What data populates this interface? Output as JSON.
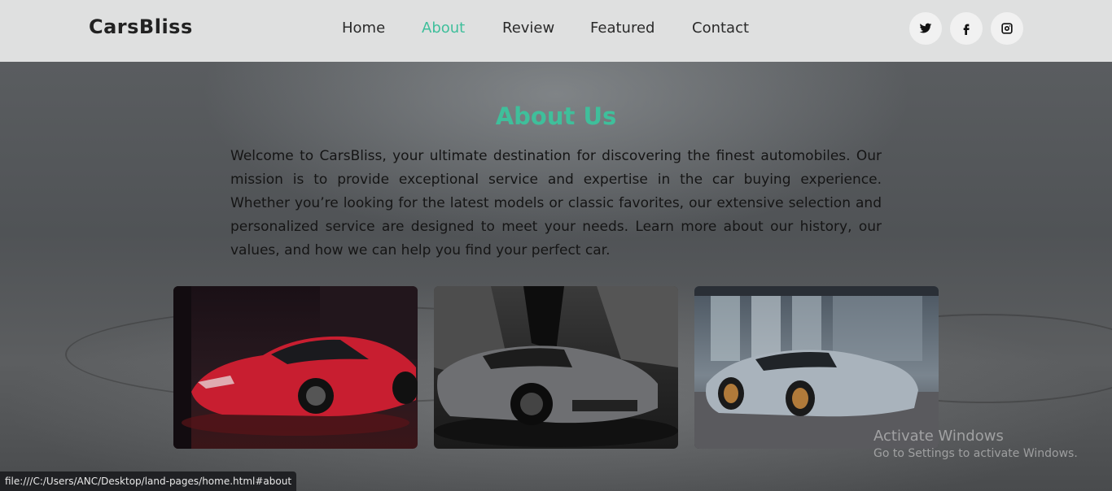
{
  "header": {
    "brand": "CarsBliss",
    "nav": [
      "Home",
      "About",
      "Review",
      "Featured",
      "Contact"
    ],
    "active_nav": "About",
    "social_icons": [
      "twitter-icon",
      "facebook-icon",
      "instagram-icon"
    ]
  },
  "about": {
    "title": "About Us",
    "paragraph": "Welcome to CarsBliss, your ultimate destination for discovering the finest automobiles. Our mission is to provide exceptional service and expertise in the car buying experience. Whether you’re looking for the latest models or classic favorites, our extensive selection and personalized service are designed to meet your needs. Learn more about our history, our values, and how we can help you find your perfect car.",
    "cards": [
      "red-sports-car-image",
      "gray-supercar-image",
      "silver-concept-car-image"
    ]
  },
  "overlay": {
    "watermark_title": "Activate Windows",
    "watermark_sub": "Go to Settings to activate Windows.",
    "status_url": "file:///C:/Users/ANC/Desktop/land-pages/home.html#about"
  },
  "colors": {
    "accent": "#3fbf9b",
    "header_bg": "#dfe0e0",
    "text_dark": "#151515"
  }
}
